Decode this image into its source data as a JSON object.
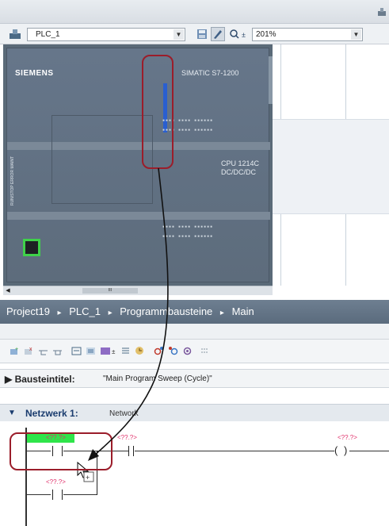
{
  "device_toolbar": {
    "device_name": "PLC_1",
    "zoom": "201%"
  },
  "plc": {
    "brand": "SIEMENS",
    "model": "SIMATIC S7-1200",
    "cpu_line1": "CPU 1214C",
    "cpu_line2": "DC/DC/DC",
    "io_row_1": "▪▪▪▪ ▪▪▪▪ ▪▪▪▪▪▪",
    "io_row_2": "▪▪.▪ ▪▪▪▪▪▪ ▪▪▪▪▪▪",
    "io_row_3": "▪▪▪ ▪▪▪▪▪▪ ▪▪▪",
    "side_text": "RUN/STOP ERROR MAINT",
    "scroll_thumb_label": "III"
  },
  "breadcrumb": {
    "items": [
      "Project19",
      "PLC_1",
      "Programmbausteine",
      "Main"
    ],
    "separator": "▸"
  },
  "block_title": {
    "label": "Bausteintitel:",
    "value": "\"Main Program Sweep (Cycle)\""
  },
  "network": {
    "label": "Netzwerk 1:",
    "comment": "Network"
  },
  "ladder": {
    "op1_label": "<??.?>",
    "op2_label": "<??.?>",
    "coil_label": "<??.?>",
    "op3_label": "<??.?>"
  }
}
